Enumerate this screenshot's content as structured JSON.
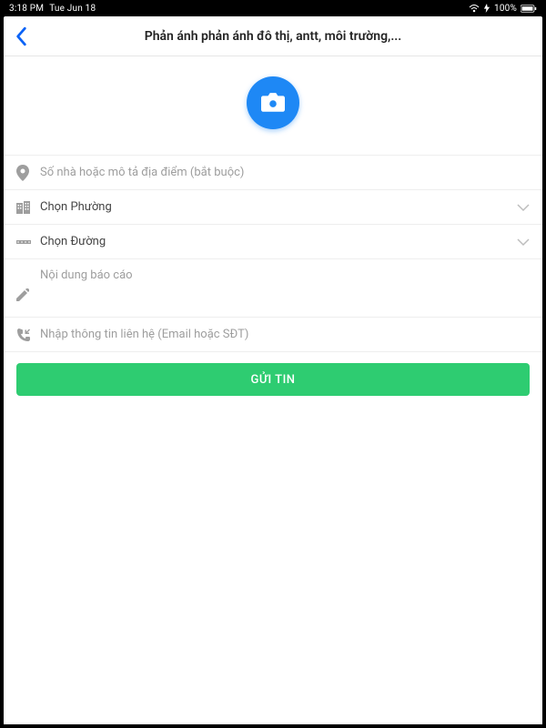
{
  "status": {
    "time": "3:18 PM",
    "date": "Tue Jun 18",
    "battery": "100%",
    "wifi": true
  },
  "header": {
    "title": "Phản ánh phản ánh đô thị, antt, môi trường,..."
  },
  "camera": {
    "icon_name": "camera-icon"
  },
  "fields": {
    "address": {
      "placeholder": "Số nhà hoặc mô tả địa điểm (bắt buộc)",
      "value": ""
    },
    "ward": {
      "label": "Chọn Phường"
    },
    "street": {
      "label": "Chọn Đường"
    },
    "content": {
      "placeholder": "Nội dung báo cáo",
      "value": ""
    },
    "contact": {
      "placeholder": "Nhập thông tin liên hệ (Email hoặc SĐT)",
      "value": ""
    }
  },
  "submit": {
    "label": "GỬI TIN"
  },
  "colors": {
    "accent_blue": "#1e88f5",
    "submit_green": "#2ecc71",
    "back_blue": "#0b63f6"
  }
}
